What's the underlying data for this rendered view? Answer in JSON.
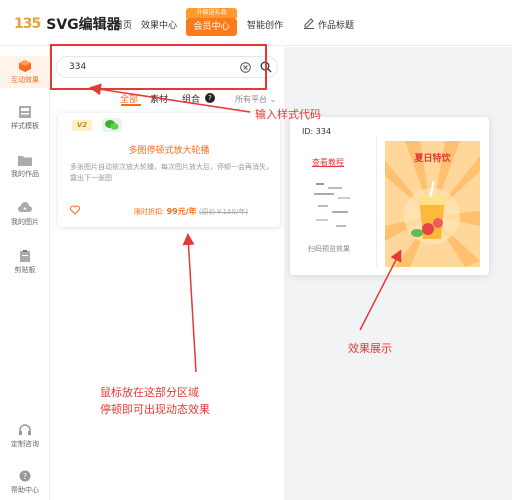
{
  "header": {
    "logo_mark": "135",
    "app_name": "SVG编辑器",
    "nav": [
      "首页",
      "效果中心"
    ],
    "vip_badge": "升级送礼品",
    "vip_button": "会员中心",
    "smart_create": "智能创作",
    "work_title": "作品标题"
  },
  "sidebar": {
    "items": [
      {
        "label": "互动效果",
        "icon": "cube-icon",
        "active": true
      },
      {
        "label": "样式模板",
        "icon": "template-icon"
      },
      {
        "label": "我的作品",
        "icon": "folder-icon"
      },
      {
        "label": "我的图片",
        "icon": "cloud-upload-icon"
      },
      {
        "label": "剪贴板",
        "icon": "clipboard-icon"
      },
      {
        "label": "定制咨询",
        "icon": "headset-icon"
      },
      {
        "label": "帮助中心",
        "icon": "help-icon"
      }
    ]
  },
  "search": {
    "value": "334"
  },
  "tabs": {
    "items": [
      "全部",
      "素材",
      "组合"
    ],
    "active": "全部",
    "platform": "所有平台"
  },
  "card": {
    "version_badge": "V2",
    "title": "多图停顿式放大轮播",
    "description": "多张图片自动依次放大轮播，每次图片放大后，停顿一会再消失，露出下一张图",
    "price_label": "限时折扣:",
    "price": "99元/年",
    "original_price": "(原价￥150/年)"
  },
  "preview": {
    "id_label": "ID: 334",
    "tutorial_link": "查看教程",
    "scan_hint": "扫码预览效果",
    "promo_title": "夏日特饮"
  },
  "annotations": {
    "input_code": "输入样式代码",
    "effect_display": "效果展示",
    "hover_line1": "鼠标放在这部分区域",
    "hover_line2": "停顿即可出现动态效果"
  },
  "colors": {
    "accent": "#ff6a1a",
    "annotation": "#e53935",
    "vip": "#ff7a1a"
  }
}
